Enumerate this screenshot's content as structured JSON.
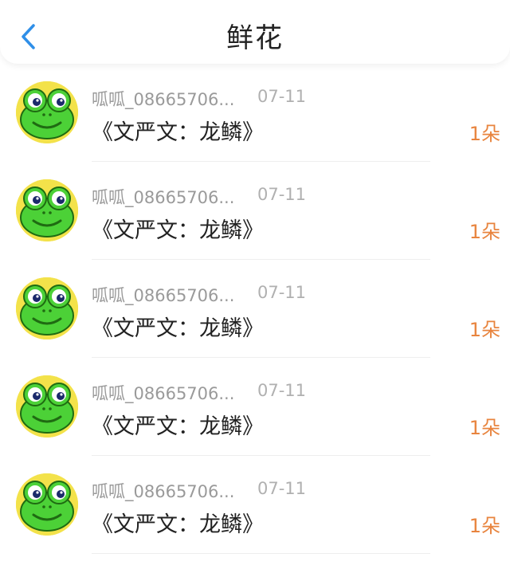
{
  "header": {
    "title": "鲜花",
    "back_icon": "chevron-left-icon",
    "accent_color": "#2f8fe8"
  },
  "gifts": [
    {
      "user": "呱呱_08665706...",
      "date": "07-11",
      "book": "《文严文：龙鳞》",
      "count": "1朵"
    },
    {
      "user": "呱呱_08665706...",
      "date": "07-11",
      "book": "《文严文：龙鳞》",
      "count": "1朵"
    },
    {
      "user": "呱呱_08665706...",
      "date": "07-11",
      "book": "《文严文：龙鳞》",
      "count": "1朵"
    },
    {
      "user": "呱呱_08665706...",
      "date": "07-11",
      "book": "《文严文：龙鳞》",
      "count": "1朵"
    },
    {
      "user": "呱呱_08665706...",
      "date": "07-11",
      "book": "《文严文：龙鳞》",
      "count": "1朵"
    }
  ],
  "colors": {
    "count": "#e8843e",
    "avatar_bg": "#f3e24a",
    "frog_green": "#4cd137"
  }
}
